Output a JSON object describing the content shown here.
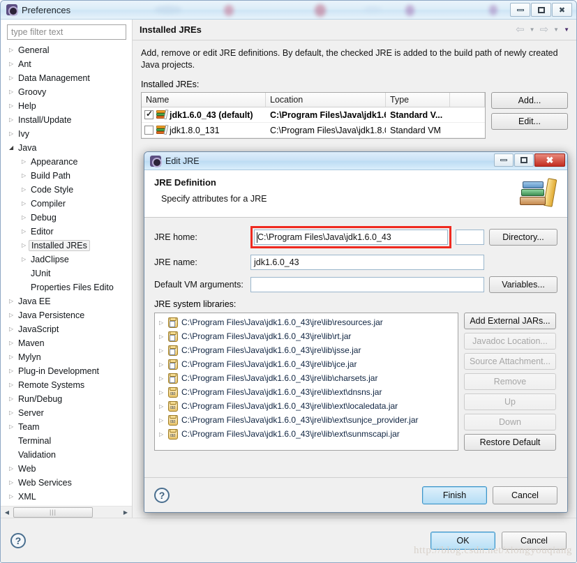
{
  "prefs_window": {
    "title": "Preferences",
    "icon": "eclipse-preferences-icon",
    "window_buttons": {
      "minimize": "minimize-icon",
      "maximize": "maximize-icon",
      "close": "close-icon"
    },
    "filter": {
      "placeholder": "type filter text",
      "value": ""
    },
    "tree": [
      {
        "label": "General",
        "level": 1,
        "expander": "collapsed"
      },
      {
        "label": "Ant",
        "level": 1,
        "expander": "collapsed"
      },
      {
        "label": "Data Management",
        "level": 1,
        "expander": "collapsed"
      },
      {
        "label": "Groovy",
        "level": 1,
        "expander": "collapsed"
      },
      {
        "label": "Help",
        "level": 1,
        "expander": "collapsed"
      },
      {
        "label": "Install/Update",
        "level": 1,
        "expander": "collapsed"
      },
      {
        "label": "Ivy",
        "level": 1,
        "expander": "collapsed"
      },
      {
        "label": "Java",
        "level": 1,
        "expander": "expanded"
      },
      {
        "label": "Appearance",
        "level": 2,
        "expander": "collapsed"
      },
      {
        "label": "Build Path",
        "level": 2,
        "expander": "collapsed"
      },
      {
        "label": "Code Style",
        "level": 2,
        "expander": "collapsed"
      },
      {
        "label": "Compiler",
        "level": 2,
        "expander": "collapsed"
      },
      {
        "label": "Debug",
        "level": 2,
        "expander": "collapsed"
      },
      {
        "label": "Editor",
        "level": 2,
        "expander": "collapsed"
      },
      {
        "label": "Installed JREs",
        "level": 2,
        "expander": "collapsed",
        "selected": true
      },
      {
        "label": "JadClipse",
        "level": 2,
        "expander": "collapsed"
      },
      {
        "label": "JUnit",
        "level": 2,
        "expander": "none"
      },
      {
        "label": "Properties Files Edito",
        "level": 2,
        "expander": "none"
      },
      {
        "label": "Java EE",
        "level": 1,
        "expander": "collapsed"
      },
      {
        "label": "Java Persistence",
        "level": 1,
        "expander": "collapsed"
      },
      {
        "label": "JavaScript",
        "level": 1,
        "expander": "collapsed"
      },
      {
        "label": "Maven",
        "level": 1,
        "expander": "collapsed"
      },
      {
        "label": "Mylyn",
        "level": 1,
        "expander": "collapsed"
      },
      {
        "label": "Plug-in Development",
        "level": 1,
        "expander": "collapsed"
      },
      {
        "label": "Remote Systems",
        "level": 1,
        "expander": "collapsed"
      },
      {
        "label": "Run/Debug",
        "level": 1,
        "expander": "collapsed"
      },
      {
        "label": "Server",
        "level": 1,
        "expander": "collapsed"
      },
      {
        "label": "Team",
        "level": 1,
        "expander": "collapsed"
      },
      {
        "label": "Terminal",
        "level": 1,
        "expander": "none"
      },
      {
        "label": "Validation",
        "level": 1,
        "expander": "none"
      },
      {
        "label": "Web",
        "level": 1,
        "expander": "collapsed"
      },
      {
        "label": "Web Services",
        "level": 1,
        "expander": "collapsed"
      },
      {
        "label": "XML",
        "level": 1,
        "expander": "collapsed"
      }
    ],
    "main": {
      "title": "Installed JREs",
      "description": "Add, remove or edit JRE definitions. By default, the checked JRE is added to the build path of newly created Java projects.",
      "list_label": "Installed JREs:",
      "nav": {
        "back": "back-arrow-icon",
        "back_menu": "chevron-down-icon",
        "forward": "forward-arrow-icon",
        "forward_menu": "chevron-down-icon",
        "view_menu": "view-menu-icon"
      },
      "table": {
        "columns": [
          "Name",
          "Location",
          "Type"
        ],
        "rows": [
          {
            "checked": true,
            "name": "jdk1.6.0_43 (default)",
            "location": "C:\\Program Files\\Java\\jdk1.6....",
            "type": "Standard V...",
            "default": true
          },
          {
            "checked": false,
            "name": "jdk1.8.0_131",
            "location": "C:\\Program Files\\Java\\jdk1.8.0_...",
            "type": "Standard VM",
            "default": false
          }
        ]
      },
      "side_buttons": [
        "Add...",
        "Edit..."
      ]
    },
    "footer": {
      "help": "help-icon",
      "ok": "OK",
      "cancel": "Cancel",
      "watermark": "http://blog.csdn.net/xiongyouqiang"
    }
  },
  "jre_dialog": {
    "title": "Edit JRE",
    "icon": "eclipse-dialog-icon",
    "window_buttons": {
      "minimize": "minimize-icon",
      "maximize": "maximize-icon",
      "close": "close-icon"
    },
    "header": {
      "title": "JRE Definition",
      "subtitle": "Specify attributes for a JRE",
      "icon": "books-icon"
    },
    "fields": {
      "jre_home": {
        "label_pre": "J",
        "label_acc": "R",
        "label_post": "E home:",
        "label": "JRE home:",
        "value": "C:\\Program Files\\Java\\jdk1.6.0_43",
        "button": "Directory...",
        "highlighted": true
      },
      "jre_name": {
        "label": "JRE name:",
        "value": "jdk1.6.0_43"
      },
      "vm_args": {
        "label": "Default VM arguments:",
        "value": "",
        "button": "Variables..."
      }
    },
    "syslib_label": "JRE system libraries:",
    "libraries": [
      {
        "path": "C:\\Program Files\\Java\\jdk1.6.0_43\\jre\\lib\\resources.jar",
        "kind": "jar"
      },
      {
        "path": "C:\\Program Files\\Java\\jdk1.6.0_43\\jre\\lib\\rt.jar",
        "kind": "jar"
      },
      {
        "path": "C:\\Program Files\\Java\\jdk1.6.0_43\\jre\\lib\\jsse.jar",
        "kind": "jar"
      },
      {
        "path": "C:\\Program Files\\Java\\jdk1.6.0_43\\jre\\lib\\jce.jar",
        "kind": "jar"
      },
      {
        "path": "C:\\Program Files\\Java\\jdk1.6.0_43\\jre\\lib\\charsets.jar",
        "kind": "jar"
      },
      {
        "path": "C:\\Program Files\\Java\\jdk1.6.0_43\\jre\\lib\\ext\\dnsns.jar",
        "kind": "ext"
      },
      {
        "path": "C:\\Program Files\\Java\\jdk1.6.0_43\\jre\\lib\\ext\\localedata.jar",
        "kind": "ext"
      },
      {
        "path": "C:\\Program Files\\Java\\jdk1.6.0_43\\jre\\lib\\ext\\sunjce_provider.jar",
        "kind": "ext"
      },
      {
        "path": "C:\\Program Files\\Java\\jdk1.6.0_43\\jre\\lib\\ext\\sunmscapi.jar",
        "kind": "ext"
      }
    ],
    "library_buttons": [
      {
        "label": "Add External JARs...",
        "enabled": true
      },
      {
        "label": "Javadoc Location...",
        "enabled": false
      },
      {
        "label": "Source Attachment...",
        "enabled": false
      },
      {
        "label": "Remove",
        "enabled": false
      },
      {
        "label": "Up",
        "enabled": false
      },
      {
        "label": "Down",
        "enabled": false
      },
      {
        "label": "Restore Default",
        "enabled": true
      }
    ],
    "footer": {
      "help": "help-icon",
      "finish": "Finish",
      "cancel": "Cancel"
    }
  },
  "colors": {
    "titlebar_blue": "#cfe6f6",
    "highlight_red": "#ef2a20",
    "default_button_blue": "#b4ddf5",
    "panel_gray": "#f0f0f0"
  }
}
